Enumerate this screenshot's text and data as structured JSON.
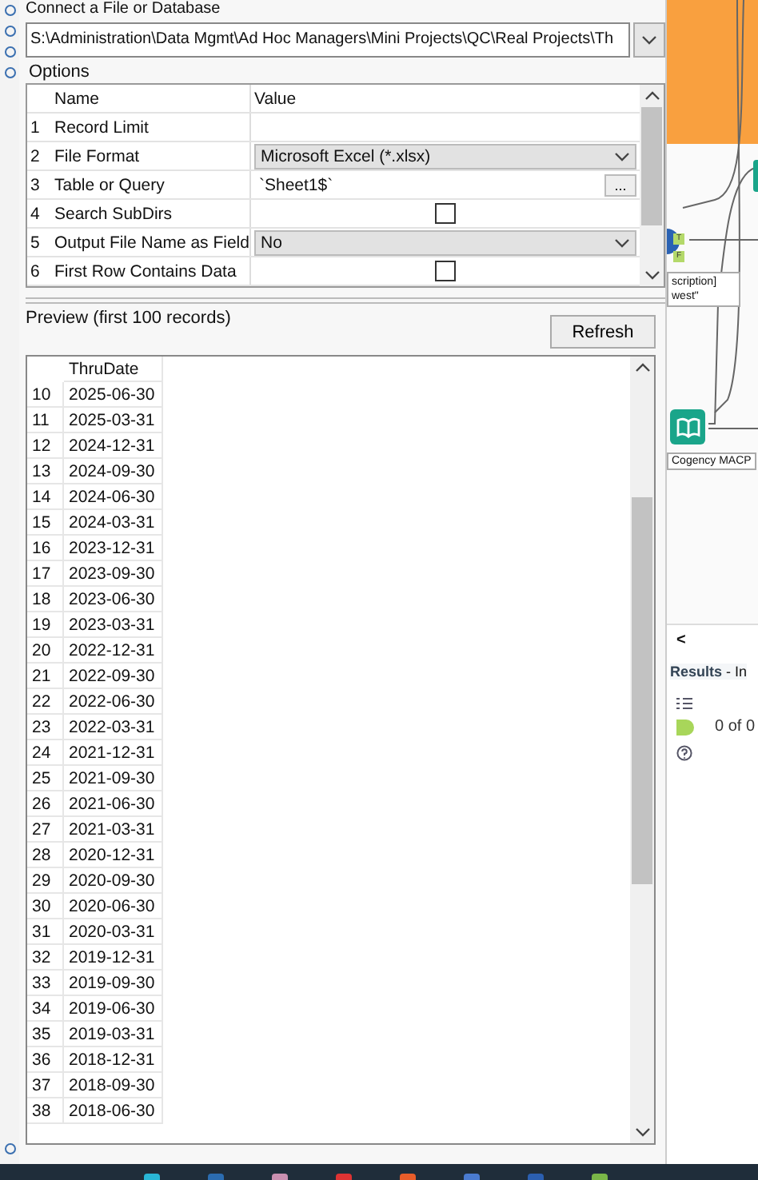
{
  "connect": {
    "label": "Connect a File or Database",
    "path": "S:\\Administration\\Data Mgmt\\Ad Hoc Managers\\Mini Projects\\QC\\Real Projects\\Th"
  },
  "options": {
    "label": "Options",
    "columns": [
      "Name",
      "Value"
    ],
    "rows": [
      {
        "index": "1",
        "name": "Record Limit",
        "kind": "text"
      },
      {
        "index": "2",
        "name": "File Format",
        "kind": "dropdown",
        "value": "Microsoft Excel (*.xlsx)"
      },
      {
        "index": "3",
        "name": "Table or Query",
        "kind": "browse",
        "value": "`Sheet1$`",
        "button": "..."
      },
      {
        "index": "4",
        "name": "Search SubDirs",
        "kind": "checkbox",
        "checked": false
      },
      {
        "index": "5",
        "name": "Output File Name as Field",
        "kind": "dropdown",
        "value": "No"
      },
      {
        "index": "6",
        "name": "First Row Contains Data",
        "kind": "checkbox",
        "checked": false
      }
    ]
  },
  "preview": {
    "label": "Preview (first 100 records)",
    "refresh": "Refresh",
    "column": "ThruDate",
    "rows": [
      {
        "n": "10",
        "date": "2025-06-30"
      },
      {
        "n": "11",
        "date": "2025-03-31"
      },
      {
        "n": "12",
        "date": "2024-12-31"
      },
      {
        "n": "13",
        "date": "2024-09-30"
      },
      {
        "n": "14",
        "date": "2024-06-30"
      },
      {
        "n": "15",
        "date": "2024-03-31"
      },
      {
        "n": "16",
        "date": "2023-12-31"
      },
      {
        "n": "17",
        "date": "2023-09-30"
      },
      {
        "n": "18",
        "date": "2023-06-30"
      },
      {
        "n": "19",
        "date": "2023-03-31"
      },
      {
        "n": "20",
        "date": "2022-12-31"
      },
      {
        "n": "21",
        "date": "2022-09-30"
      },
      {
        "n": "22",
        "date": "2022-06-30"
      },
      {
        "n": "23",
        "date": "2022-03-31"
      },
      {
        "n": "24",
        "date": "2021-12-31"
      },
      {
        "n": "25",
        "date": "2021-09-30"
      },
      {
        "n": "26",
        "date": "2021-06-30"
      },
      {
        "n": "27",
        "date": "2021-03-31"
      },
      {
        "n": "28",
        "date": "2020-12-31"
      },
      {
        "n": "29",
        "date": "2020-09-30"
      },
      {
        "n": "30",
        "date": "2020-06-30"
      },
      {
        "n": "31",
        "date": "2020-03-31"
      },
      {
        "n": "32",
        "date": "2019-12-31"
      },
      {
        "n": "33",
        "date": "2019-09-30"
      },
      {
        "n": "34",
        "date": "2019-06-30"
      },
      {
        "n": "35",
        "date": "2019-03-31"
      },
      {
        "n": "36",
        "date": "2018-12-31"
      },
      {
        "n": "37",
        "date": "2018-09-30"
      },
      {
        "n": "38",
        "date": "2018-06-30"
      }
    ]
  },
  "canvas": {
    "note_lines": [
      "scription]",
      "west\""
    ],
    "node_label": "Cogency MACP",
    "anchors": [
      "T",
      "F"
    ]
  },
  "results": {
    "collapse": "<",
    "title": "Results",
    "subtitle": "- In",
    "count": "0 of 0"
  }
}
